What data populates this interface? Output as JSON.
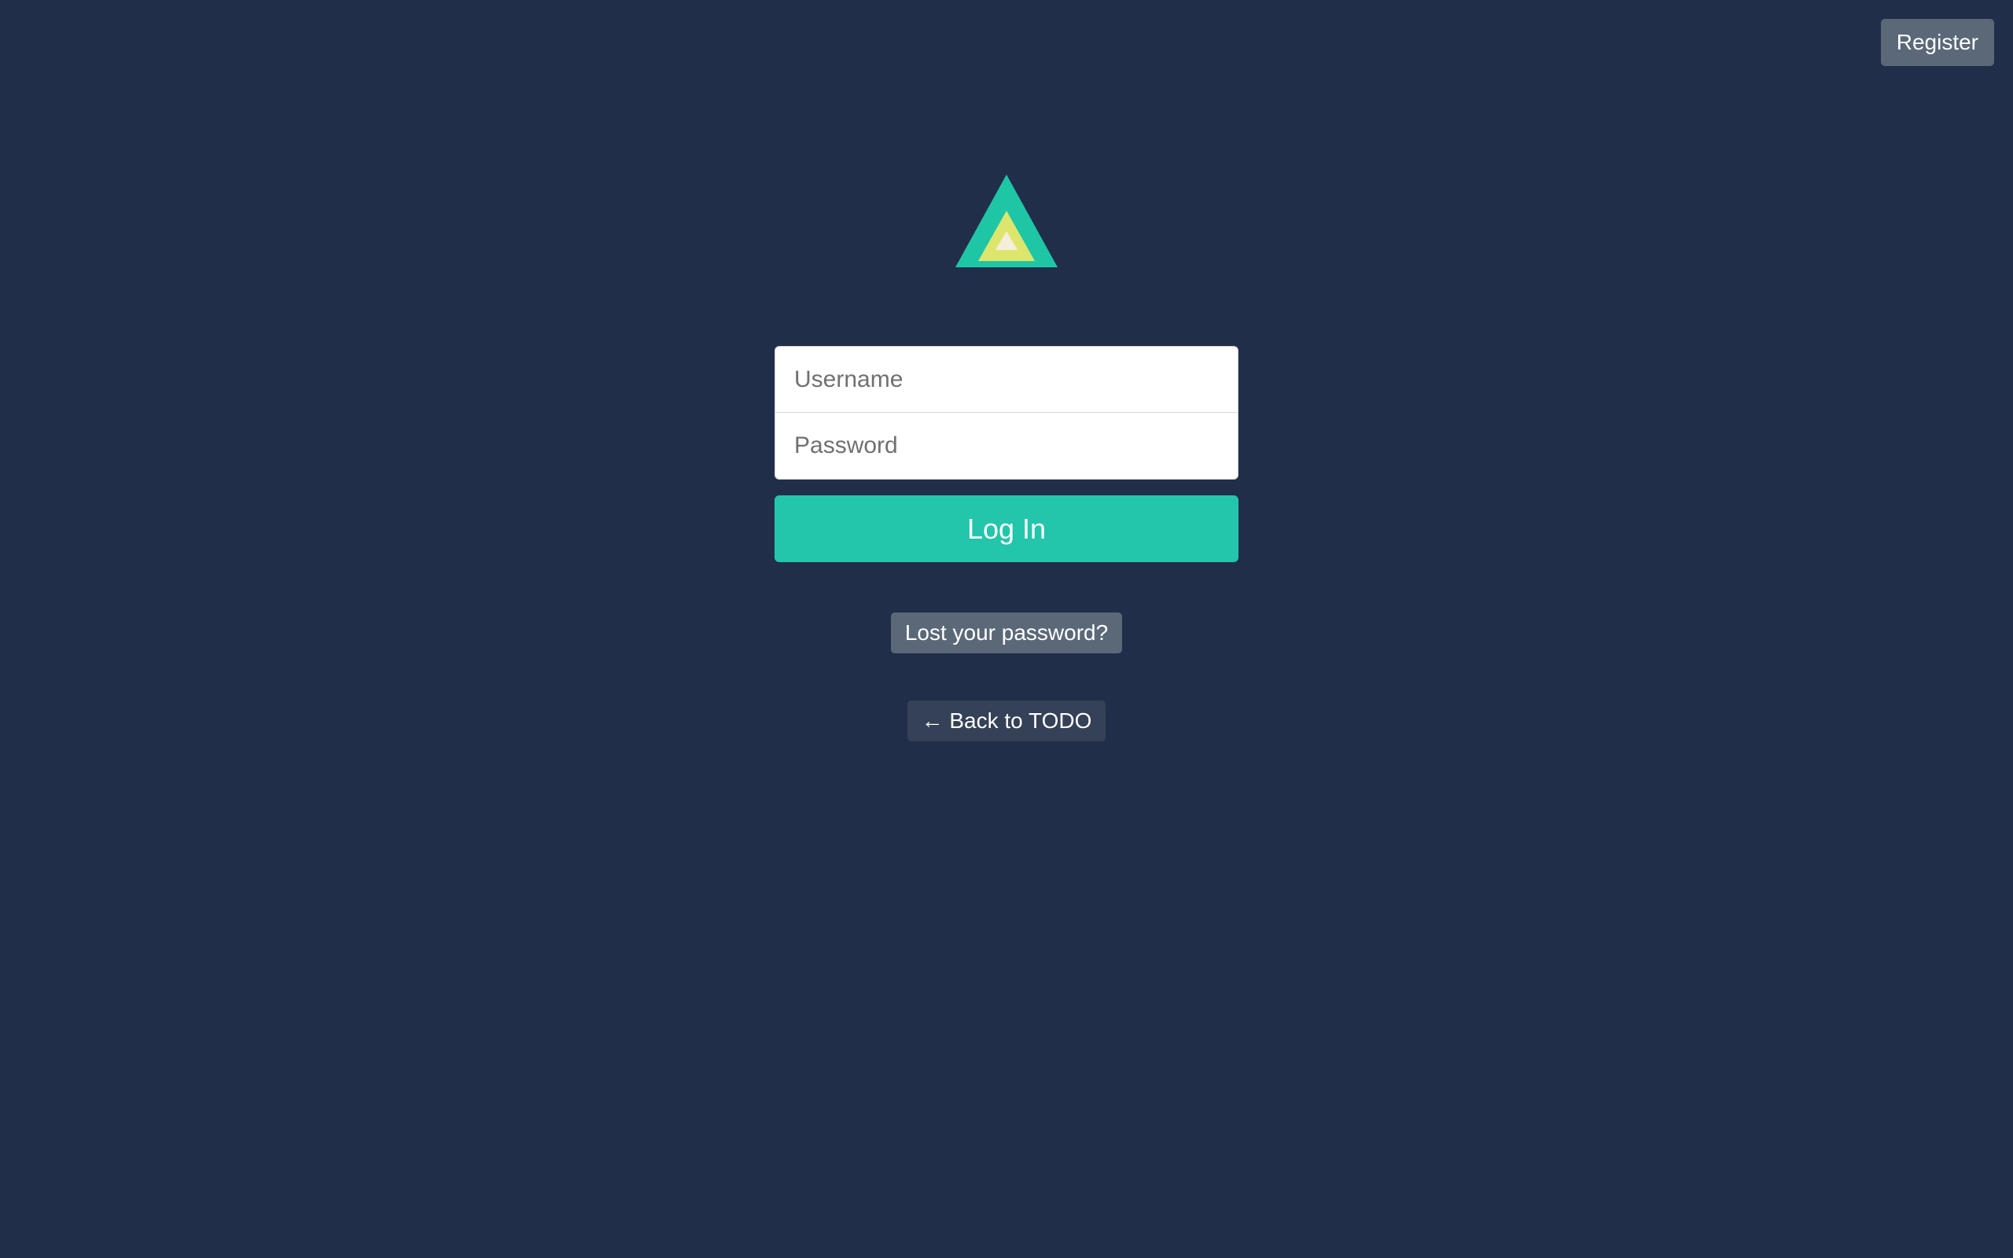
{
  "header": {
    "register_label": "Register"
  },
  "form": {
    "username_placeholder": "Username",
    "password_placeholder": "Password",
    "login_label": "Log In"
  },
  "links": {
    "lost_password_label": "Lost your password?",
    "back_label": "← Back to TODO"
  }
}
